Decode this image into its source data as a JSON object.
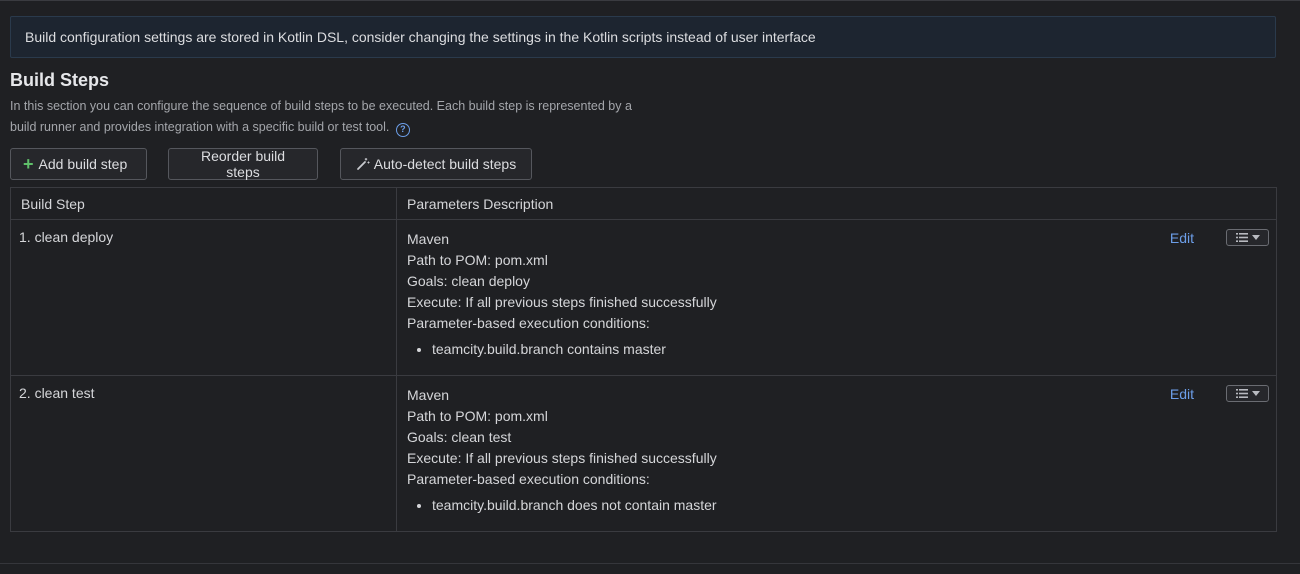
{
  "banner": {
    "text": "Build configuration settings are stored in Kotlin DSL, consider changing the settings in the Kotlin scripts instead of user interface"
  },
  "section": {
    "title": "Build Steps",
    "description_line1": "In this section you can configure the sequence of build steps to be executed. Each build step is represented by a",
    "description_line2": "build runner and provides integration with a specific build or test tool.",
    "help_icon": "question-circle-icon"
  },
  "toolbar": {
    "add_label": "Add build step",
    "reorder_label": "Reorder build steps",
    "autodetect_label": "Auto-detect build steps",
    "add_icon": "plus-icon",
    "autodetect_icon": "magic-wand-icon"
  },
  "table": {
    "headers": {
      "step": "Build Step",
      "params": "Parameters Description"
    },
    "rows": [
      {
        "step": "1. clean deploy",
        "runner": "Maven",
        "path": "Path to POM: pom.xml",
        "goals": "Goals: clean deploy",
        "execute": "Execute: If all previous steps finished successfully",
        "conditions_label": "Parameter-based execution conditions:",
        "conditions": [
          "teamcity.build.branch contains master"
        ],
        "edit_label": "Edit"
      },
      {
        "step": "2. clean test",
        "runner": "Maven",
        "path": "Path to POM: pom.xml",
        "goals": "Goals: clean test",
        "execute": "Execute: If all previous steps finished successfully",
        "conditions_label": "Parameter-based execution conditions:",
        "conditions": [
          "teamcity.build.branch does not contain master"
        ],
        "edit_label": "Edit"
      }
    ]
  },
  "colors": {
    "background": "#1f2023",
    "accent_link": "#6c9ee8",
    "add_icon": "#5fbf6a",
    "border": "#3a3b40"
  }
}
